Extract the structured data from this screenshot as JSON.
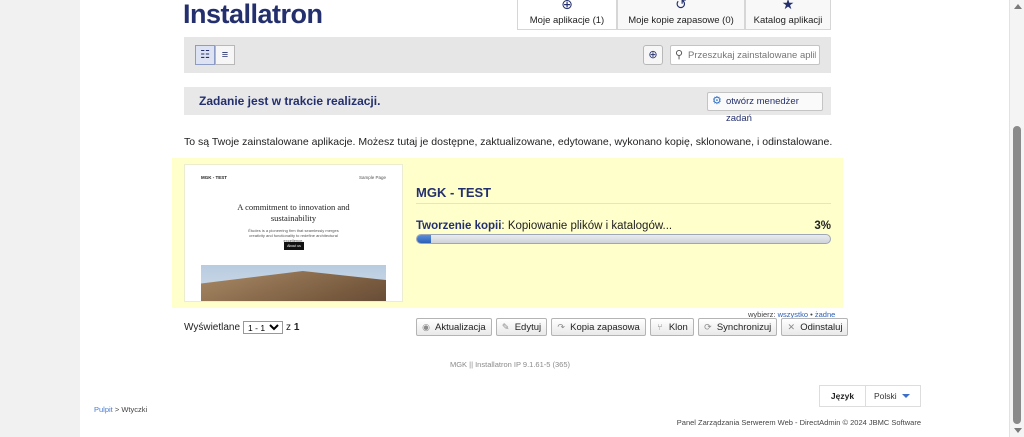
{
  "brand": {
    "logo_text": "Installatron",
    "accent_color": "#24306e",
    "link_color": "#2d5fb5"
  },
  "tabs": [
    {
      "label": "Moje aplikacje (1)",
      "icon": "download-circle-icon"
    },
    {
      "label": "Moje kopie zapasowe (0)",
      "icon": "restore-icon"
    },
    {
      "label": "Katalog aplikacji",
      "icon": "star-icon"
    }
  ],
  "toolbar": {
    "search_placeholder": "Przeszukaj zainstalowane aplika"
  },
  "task": {
    "message": "Zadanie jest w trakcie realizacji.",
    "button_label": "otwórz menedżer zadań"
  },
  "intro_text": "To są Twoje zainstalowane aplikacje. Możesz tutaj je dostępne, zaktualizowane, edytowane, wykonano kopię, sklonowane, i odinstalowane.",
  "app": {
    "name": "MGK - TEST",
    "thumbnail": {
      "site_title": "MGK - TEST",
      "nav_link": "Sample Page",
      "headline": "A commitment to innovation and sustainability",
      "body": "Études is a pioneering firm that seamlessly merges creativity and functionality to redefine architectural excellence.",
      "button": "About us"
    },
    "progress": {
      "label": "Tworzenie kopii",
      "status": "Kopiowanie plików i katalogów...",
      "percent_text": "3%",
      "value": 0.03
    }
  },
  "selection": {
    "prefix": "wybierz:",
    "all": "wszystko",
    "sep": "•",
    "none": "żadne"
  },
  "pager": {
    "label": "Wyświetlane",
    "value": "1 - 1",
    "of": "z",
    "total": "1"
  },
  "actions": [
    {
      "label": "Aktualizacja",
      "icon": "update-icon"
    },
    {
      "label": "Edytuj",
      "icon": "wrench-icon"
    },
    {
      "label": "Kopia zapasowa",
      "icon": "backup-arrow-icon"
    },
    {
      "label": "Klon",
      "icon": "clone-icon"
    },
    {
      "label": "Synchronizuj",
      "icon": "sync-icon"
    },
    {
      "label": "Odinstaluj",
      "icon": "close-icon"
    }
  ],
  "footer": {
    "version": "MGK || Installatron IP 9.1.61-5 (365)",
    "language_label": "Język",
    "language_value": "Polski",
    "breadcrumb_home": "Pulpit",
    "breadcrumb_sep": ">",
    "breadcrumb_current": "Wtyczki",
    "copyright": "Panel Zarządzania Serwerem Web - DirectAdmin © 2024 JBMC Software"
  }
}
